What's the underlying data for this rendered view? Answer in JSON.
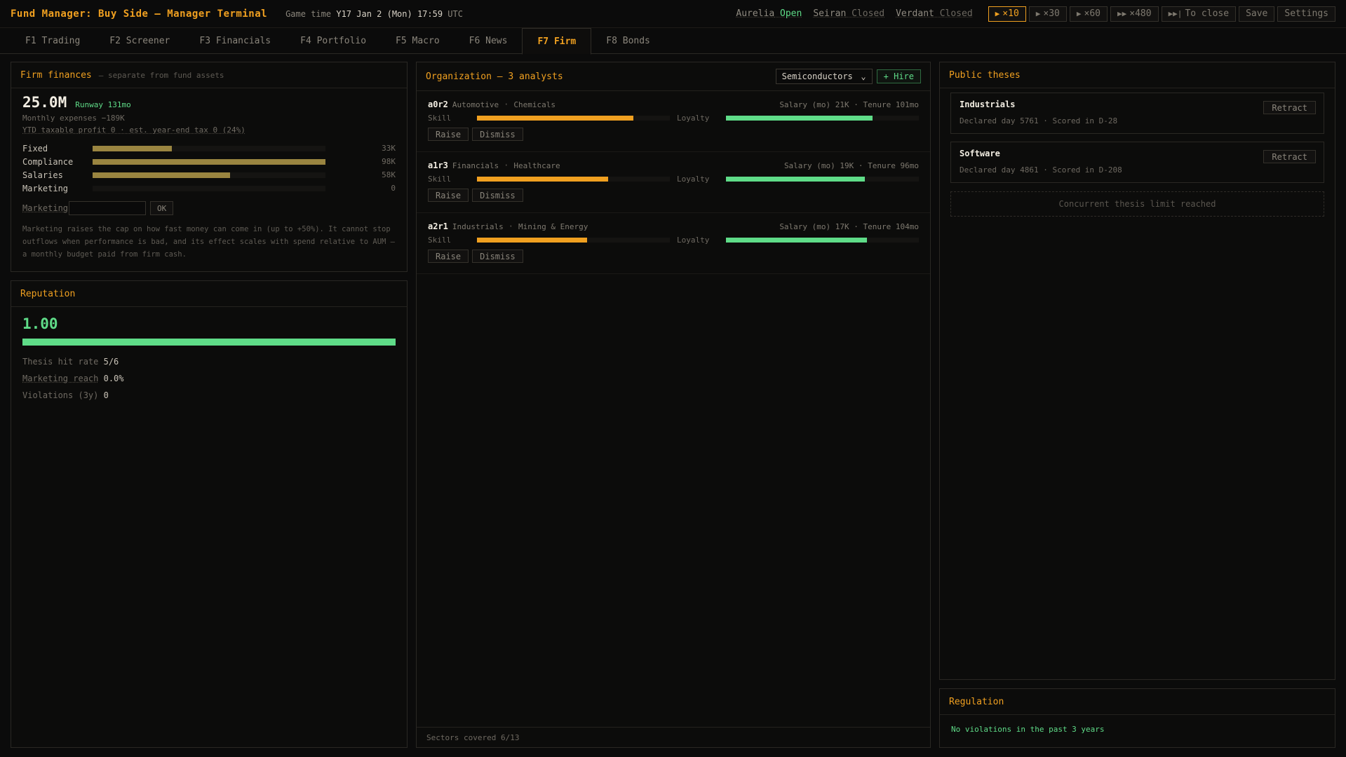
{
  "app": {
    "title": "Fund Manager: Buy Side — Manager Terminal",
    "game_time_label": "Game time",
    "game_time_value": "Y17 Jan 2 (Mon) 17:59",
    "game_time_tz": "UTC"
  },
  "markets": [
    {
      "name": "Aurelia",
      "status": "Open"
    },
    {
      "name": "Seiran",
      "status": "Closed"
    },
    {
      "name": "Verdant",
      "status": "Closed"
    }
  ],
  "speed_controls": [
    {
      "icon": "▶",
      "label": "×10",
      "active": true
    },
    {
      "icon": "▶",
      "label": "×30",
      "active": false
    },
    {
      "icon": "▶",
      "label": "×60",
      "active": false
    },
    {
      "icon": "▶▶",
      "label": "×480",
      "active": false
    },
    {
      "icon": "▶▶|",
      "label": "To close",
      "active": false
    }
  ],
  "toolbar": {
    "save_label": "Save",
    "settings_label": "Settings"
  },
  "tabs": [
    {
      "label": "F1 Trading",
      "active": false
    },
    {
      "label": "F2 Screener",
      "active": false
    },
    {
      "label": "F3 Financials",
      "active": false
    },
    {
      "label": "F4 Portfolio",
      "active": false
    },
    {
      "label": "F5 Macro",
      "active": false
    },
    {
      "label": "F6 News",
      "active": false
    },
    {
      "label": "F7 Firm",
      "active": true
    },
    {
      "label": "F8 Bonds",
      "active": false
    }
  ],
  "firm_finances": {
    "title": "Firm finances",
    "subtitle": "— separate from fund assets",
    "cash": "25.0M",
    "runway": "Runway 131mo",
    "monthly_expenses": "Monthly expenses −189K",
    "ytd_line": "YTD taxable profit 0 · est. year-end tax 0 (24%)",
    "expenses": [
      {
        "label": "Fixed",
        "value": "33K",
        "fraction": 0.34
      },
      {
        "label": "Compliance",
        "value": "98K",
        "fraction": 1.0
      },
      {
        "label": "Salaries",
        "value": "58K",
        "fraction": 0.59
      },
      {
        "label": "Marketing",
        "value": "0",
        "fraction": 0.0
      }
    ],
    "marketing_label": "Marketing",
    "marketing_input_value": "",
    "ok_label": "OK",
    "note": "Marketing raises the cap on how fast money can come in (up to +50%). It cannot stop outflows when performance is bad, and its effect scales with spend relative to AUM — a monthly budget paid from firm cash.",
    "bar_color": "#9a8540"
  },
  "reputation": {
    "title": "Reputation",
    "score": "1.00",
    "level": 1.0,
    "stats": [
      {
        "key": "Thesis hit rate",
        "value": "5/6"
      },
      {
        "key": "Marketing reach",
        "value": "0.0%"
      },
      {
        "key": "Violations (3y)",
        "value": "0"
      }
    ]
  },
  "organization": {
    "title": "Organization — 3 analysts",
    "sector_select": "Semiconductors",
    "hire_label": "+ Hire",
    "skill_label": "Skill",
    "loyalty_label": "Loyalty",
    "raise_label": "Raise",
    "dismiss_label": "Dismiss",
    "analysts": [
      {
        "id": "a0r2",
        "sector1": "Automotive",
        "sector2": "Chemicals",
        "info": "Salary (mo) 21K · Tenure 101mo",
        "skill": 0.81,
        "loyalty": 0.76
      },
      {
        "id": "a1r3",
        "sector1": "Financials",
        "sector2": "Healthcare",
        "info": "Salary (mo) 19K · Tenure 96mo",
        "skill": 0.68,
        "loyalty": 0.72
      },
      {
        "id": "a2r1",
        "sector1": "Industrials",
        "sector2": "Mining & Energy",
        "info": "Salary (mo) 17K · Tenure 104mo",
        "skill": 0.57,
        "loyalty": 0.73
      }
    ],
    "footer": "Sectors covered 6/13"
  },
  "theses": {
    "title": "Public theses",
    "items": [
      {
        "name": "Industrials",
        "meta": "Declared day 5761 · Scored in D-28"
      },
      {
        "name": "Software",
        "meta": "Declared day 4861 · Scored in D-208"
      }
    ],
    "retract_label": "Retract",
    "limit_text": "Concurrent thesis limit reached"
  },
  "regulation": {
    "title": "Regulation",
    "text": "No violations in the past 3 years"
  },
  "colors": {
    "accent": "#f0a020",
    "positive": "#5fdc88",
    "background": "#0b0b0b"
  }
}
